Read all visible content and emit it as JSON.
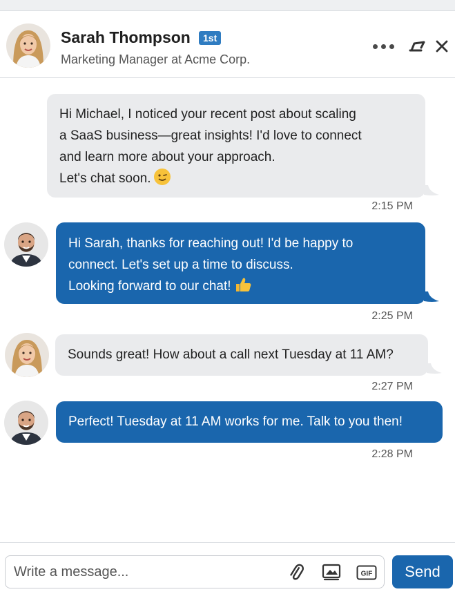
{
  "header": {
    "contact_name": "Sarah Thompson",
    "degree_badge": "1st",
    "headline": "Marketing Manager at Acme Corp."
  },
  "messages": [
    {
      "sender": "Sarah Thompson",
      "direction": "incoming",
      "lines": [
        "Hi Michael, I noticed your recent post about scaling",
        "a SaaS business—great insights! I'd love to connect",
        "and learn more about your approach.",
        "Let's chat soon."
      ],
      "emoji": "wink-emoji",
      "time": "2:15 PM"
    },
    {
      "sender": "Michael",
      "direction": "outgoing",
      "lines": [
        "Hi Sarah, thanks for reaching out! I'd  be happy to",
        "connect. Let's set up a time to discuss.",
        "Looking forward to our chat!"
      ],
      "emoji": "thumbs-up-emoji",
      "time": "2:25 PM"
    },
    {
      "sender": "Sarah Thompson",
      "direction": "incoming",
      "lines": [
        "Sounds great! How about a call next Tuesday at 11 AM?"
      ],
      "time": "2:27 PM"
    },
    {
      "sender": "Michael",
      "direction": "outgoing",
      "lines": [
        "Perfect! Tuesday at 11 AM works for me. Talk to you then!"
      ],
      "time": "2:28 PM"
    }
  ],
  "composer": {
    "placeholder": "Write a message...",
    "send_label": "Send"
  },
  "icons": [
    "more-icon",
    "minimize-icon",
    "close-icon",
    "attach-icon",
    "image-icon",
    "gif-icon"
  ],
  "colors": {
    "accent": "#1a66ad",
    "incoming_bubble": "#eaebed",
    "badge": "#2f7cc1"
  }
}
